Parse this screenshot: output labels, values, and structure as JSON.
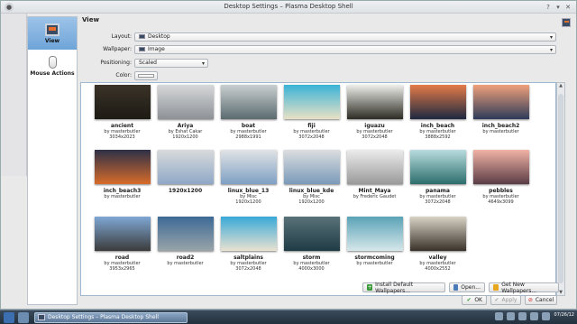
{
  "window": {
    "title": "Desktop Settings – Plasma Desktop Shell"
  },
  "sidebar": {
    "items": [
      {
        "label": "View",
        "active": true
      },
      {
        "label": "Mouse Actions",
        "active": false
      }
    ]
  },
  "view": {
    "header": "View",
    "layout_label": "Layout:",
    "layout_value": "Desktop",
    "wallpaper_label": "Wallpaper:",
    "wallpaper_value": "Image",
    "positioning_label": "Positioning:",
    "positioning_value": "Scaled",
    "color_label": "Color:"
  },
  "wallpapers": [
    {
      "name": "ancient",
      "author": "by masterbutler",
      "res": "3034x2023",
      "colors": [
        "#3a3328",
        "#1d1a14"
      ]
    },
    {
      "name": "Ariya",
      "author": "by Eshat Cakar",
      "res": "1920x1200",
      "colors": [
        "#d6d8da",
        "#8d9196"
      ]
    },
    {
      "name": "boat",
      "author": "by masterbutler",
      "res": "2988x1991",
      "colors": [
        "#c9cfd0",
        "#5b6b70"
      ]
    },
    {
      "name": "fiji",
      "author": "by masterbutler",
      "res": "3072x2048",
      "colors": [
        "#3ab3d8",
        "#e8e1c4"
      ]
    },
    {
      "name": "iguazu",
      "author": "by masterbutler",
      "res": "3072x2048",
      "colors": [
        "#eeeeea",
        "#2c2c24"
      ]
    },
    {
      "name": "inch_beach",
      "author": "by masterbutler",
      "res": "3888x2592",
      "colors": [
        "#e47a48",
        "#1d2940"
      ]
    },
    {
      "name": "inch_beach2",
      "author": "by masterbutler",
      "res": "",
      "colors": [
        "#f1a07a",
        "#2d3b5a"
      ]
    },
    {
      "name": "inch_beach3",
      "author": "by masterbutler",
      "res": "",
      "colors": [
        "#2d3047",
        "#d86b2a"
      ]
    },
    {
      "name": "1920x1200",
      "author": "",
      "res": "",
      "colors": [
        "#d8dadc",
        "#8fa8c6"
      ]
    },
    {
      "name": "linux_blue_13",
      "author": "by Misc",
      "res": "1920x1200",
      "colors": [
        "#e1e3e5",
        "#7fa0c4"
      ]
    },
    {
      "name": "linux_blue_kde",
      "author": "by Misc",
      "res": "1920x1200",
      "colors": [
        "#dcdee0",
        "#7a9ab9"
      ]
    },
    {
      "name": "Mint_Maya",
      "author": "by Frederic Gaudet",
      "res": "",
      "colors": [
        "#ececec",
        "#9a9a9a"
      ]
    },
    {
      "name": "panama",
      "author": "by masterbutler",
      "res": "3072x2048",
      "colors": [
        "#b9dcdf",
        "#2c6e6c"
      ]
    },
    {
      "name": "pebbles",
      "author": "by masterbutler",
      "res": "4649x3099",
      "colors": [
        "#f2b3a6",
        "#5b3c45"
      ]
    },
    {
      "name": "road",
      "author": "by masterbutler",
      "res": "3953x2965",
      "colors": [
        "#7fa7d4",
        "#3b3b3b"
      ]
    },
    {
      "name": "road2",
      "author": "by masterbutler",
      "res": "",
      "colors": [
        "#3d6a96",
        "#9aa4a8"
      ]
    },
    {
      "name": "saltplains",
      "author": "by masterbutler",
      "res": "3072x2048",
      "colors": [
        "#39a9d8",
        "#e9e2d0"
      ]
    },
    {
      "name": "storm",
      "author": "by masterbutler",
      "res": "4000x3000",
      "colors": [
        "#59727a",
        "#1f3b44"
      ]
    },
    {
      "name": "stormcoming",
      "author": "by masterbutler",
      "res": "",
      "colors": [
        "#5aa3b7",
        "#d7e7ea"
      ]
    },
    {
      "name": "valley",
      "author": "by masterbutler",
      "res": "4000x2552",
      "colors": [
        "#d9d2c5",
        "#38322a"
      ]
    }
  ],
  "buttons": {
    "install": "Install Default Wallpapers...",
    "open": "Open...",
    "get_new": "Get New Wallpapers...",
    "ok": "OK",
    "apply": "Apply",
    "cancel": "Cancel"
  },
  "taskbar": {
    "task_label": "Desktop Settings – Plasma Desktop Shell",
    "date": "07/26/12"
  }
}
